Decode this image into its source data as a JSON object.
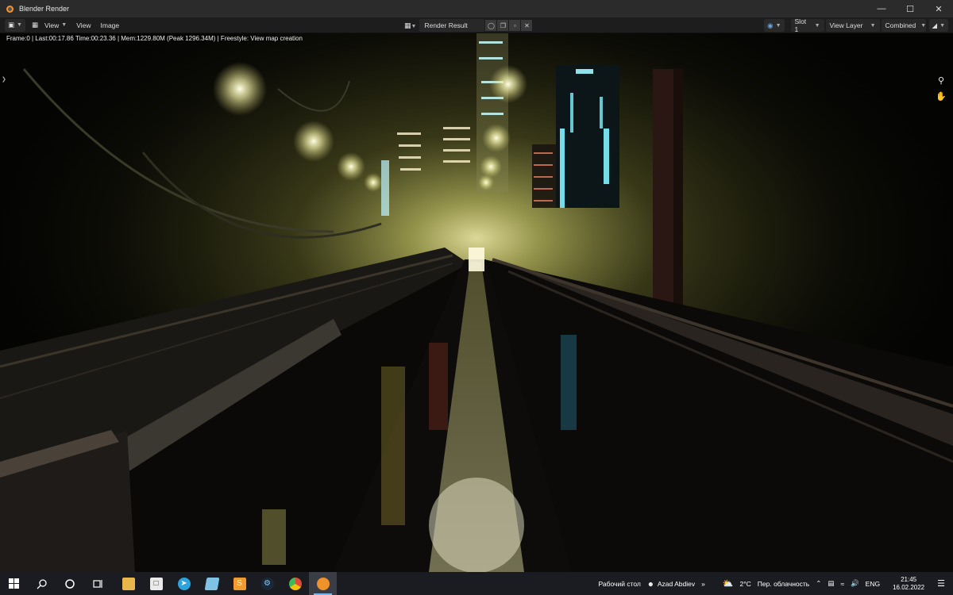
{
  "window": {
    "title": "Blender Render",
    "minimize_icon": "minimize-icon",
    "maximize_icon": "maximize-icon",
    "close_icon": "close-icon"
  },
  "header": {
    "editor_type_icon": "image-editor-icon",
    "view_menu_1": "View",
    "view_menu_2": "View",
    "image_menu": "Image",
    "image_name": "Render Result",
    "slot": "Slot 1",
    "view_layer": "View Layer",
    "pass": "Combined"
  },
  "render_info": "Frame:0 | Last:00:17.86 Time:00:23.36 | Mem:1229.80M (Peak 1296.34M) | Freestyle: View map creation",
  "viewport_tools": [
    "zoom-icon",
    "hand-pan-icon"
  ],
  "taskbar": {
    "start_icon": "windows-start-icon",
    "search_icon": "search-icon",
    "cortana_icon": "cortana-circle-icon",
    "task_view_icon": "task-view-icon",
    "apps": [
      {
        "name": "file-explorer-icon",
        "color": "#e8b64a"
      },
      {
        "name": "store-icon",
        "color": "#ffffff"
      },
      {
        "name": "telegram-icon",
        "color": "#2aa3de"
      },
      {
        "name": "app-cube-icon",
        "color": "#7ec3e6"
      },
      {
        "name": "sublime-text-icon",
        "color": "#f29a2e"
      },
      {
        "name": "steam-icon",
        "color": "#2a6ea8"
      },
      {
        "name": "chrome-icon",
        "color": "#e04a3a"
      },
      {
        "name": "blender-icon",
        "color": "#f0922a"
      }
    ],
    "desktop_label": "Рабочий стол",
    "user_name": "Azad Abdiev",
    "chevron": "»",
    "weather_temp": "2°C",
    "weather_text": "Пер. облачность",
    "language": "ENG",
    "time": "21:45",
    "date": "16.02.2022"
  }
}
